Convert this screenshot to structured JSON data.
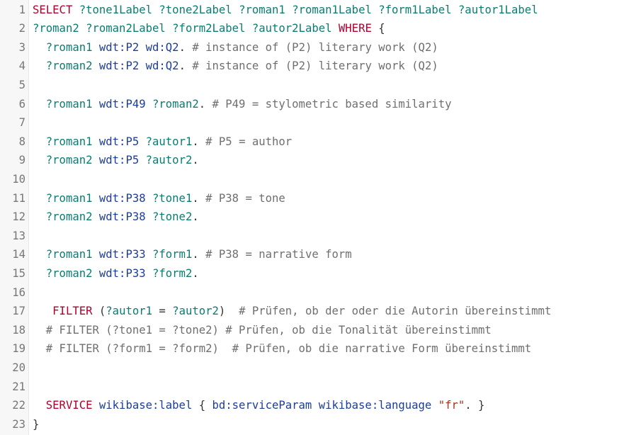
{
  "editor": {
    "lines": [
      {
        "number": "1",
        "tokens": [
          {
            "t": "kw",
            "v": "SELECT"
          },
          {
            "t": "pl",
            "v": " "
          },
          {
            "t": "var",
            "v": "?tone1Label"
          },
          {
            "t": "pl",
            "v": " "
          },
          {
            "t": "var",
            "v": "?tone2Label"
          },
          {
            "t": "pl",
            "v": " "
          },
          {
            "t": "var",
            "v": "?roman1"
          },
          {
            "t": "pl",
            "v": " "
          },
          {
            "t": "var",
            "v": "?roman1Label"
          },
          {
            "t": "pl",
            "v": " "
          },
          {
            "t": "var",
            "v": "?form1Label"
          },
          {
            "t": "pl",
            "v": " "
          },
          {
            "t": "var",
            "v": "?autor1Label"
          }
        ]
      },
      {
        "number": "2",
        "tokens": [
          {
            "t": "var",
            "v": "?roman2"
          },
          {
            "t": "pl",
            "v": " "
          },
          {
            "t": "var",
            "v": "?roman2Label"
          },
          {
            "t": "pl",
            "v": " "
          },
          {
            "t": "var",
            "v": "?form2Label"
          },
          {
            "t": "pl",
            "v": " "
          },
          {
            "t": "var",
            "v": "?autor2Label"
          },
          {
            "t": "pl",
            "v": " "
          },
          {
            "t": "kw",
            "v": "WHERE"
          },
          {
            "t": "pl",
            "v": " {"
          }
        ]
      },
      {
        "number": "3",
        "tokens": [
          {
            "t": "pl",
            "v": "  "
          },
          {
            "t": "var",
            "v": "?roman1"
          },
          {
            "t": "pl",
            "v": " "
          },
          {
            "t": "pfx",
            "v": "wdt:P2"
          },
          {
            "t": "pl",
            "v": " "
          },
          {
            "t": "pfx",
            "v": "wd:Q2"
          },
          {
            "t": "pl",
            "v": ". "
          },
          {
            "t": "cmt",
            "v": "# instance of (P2) literary work (Q2)"
          }
        ]
      },
      {
        "number": "4",
        "tokens": [
          {
            "t": "pl",
            "v": "  "
          },
          {
            "t": "var",
            "v": "?roman2"
          },
          {
            "t": "pl",
            "v": " "
          },
          {
            "t": "pfx",
            "v": "wdt:P2"
          },
          {
            "t": "pl",
            "v": " "
          },
          {
            "t": "pfx",
            "v": "wd:Q2"
          },
          {
            "t": "pl",
            "v": ". "
          },
          {
            "t": "cmt",
            "v": "# instance of (P2) literary work (Q2)"
          }
        ]
      },
      {
        "number": "5",
        "tokens": []
      },
      {
        "number": "6",
        "tokens": [
          {
            "t": "pl",
            "v": "  "
          },
          {
            "t": "var",
            "v": "?roman1"
          },
          {
            "t": "pl",
            "v": " "
          },
          {
            "t": "pfx",
            "v": "wdt:P49"
          },
          {
            "t": "pl",
            "v": " "
          },
          {
            "t": "var",
            "v": "?roman2"
          },
          {
            "t": "pl",
            "v": ". "
          },
          {
            "t": "cmt",
            "v": "# P49 = stylometric based similarity"
          }
        ]
      },
      {
        "number": "7",
        "tokens": []
      },
      {
        "number": "8",
        "tokens": [
          {
            "t": "pl",
            "v": "  "
          },
          {
            "t": "var",
            "v": "?roman1"
          },
          {
            "t": "pl",
            "v": " "
          },
          {
            "t": "pfx",
            "v": "wdt:P5"
          },
          {
            "t": "pl",
            "v": " "
          },
          {
            "t": "var",
            "v": "?autor1"
          },
          {
            "t": "pl",
            "v": ". "
          },
          {
            "t": "cmt",
            "v": "# P5 = author"
          }
        ]
      },
      {
        "number": "9",
        "tokens": [
          {
            "t": "pl",
            "v": "  "
          },
          {
            "t": "var",
            "v": "?roman2"
          },
          {
            "t": "pl",
            "v": " "
          },
          {
            "t": "pfx",
            "v": "wdt:P5"
          },
          {
            "t": "pl",
            "v": " "
          },
          {
            "t": "var",
            "v": "?autor2"
          },
          {
            "t": "pl",
            "v": "."
          }
        ]
      },
      {
        "number": "10",
        "tokens": []
      },
      {
        "number": "11",
        "tokens": [
          {
            "t": "pl",
            "v": "  "
          },
          {
            "t": "var",
            "v": "?roman1"
          },
          {
            "t": "pl",
            "v": " "
          },
          {
            "t": "pfx",
            "v": "wdt:P38"
          },
          {
            "t": "pl",
            "v": " "
          },
          {
            "t": "var",
            "v": "?tone1"
          },
          {
            "t": "pl",
            "v": ". "
          },
          {
            "t": "cmt",
            "v": "# P38 = tone"
          }
        ]
      },
      {
        "number": "12",
        "tokens": [
          {
            "t": "pl",
            "v": "  "
          },
          {
            "t": "var",
            "v": "?roman2"
          },
          {
            "t": "pl",
            "v": " "
          },
          {
            "t": "pfx",
            "v": "wdt:P38"
          },
          {
            "t": "pl",
            "v": " "
          },
          {
            "t": "var",
            "v": "?tone2"
          },
          {
            "t": "pl",
            "v": "."
          }
        ]
      },
      {
        "number": "13",
        "tokens": []
      },
      {
        "number": "14",
        "tokens": [
          {
            "t": "pl",
            "v": "  "
          },
          {
            "t": "var",
            "v": "?roman1"
          },
          {
            "t": "pl",
            "v": " "
          },
          {
            "t": "pfx",
            "v": "wdt:P33"
          },
          {
            "t": "pl",
            "v": " "
          },
          {
            "t": "var",
            "v": "?form1"
          },
          {
            "t": "pl",
            "v": ". "
          },
          {
            "t": "cmt",
            "v": "# P38 = narrative form"
          }
        ]
      },
      {
        "number": "15",
        "tokens": [
          {
            "t": "pl",
            "v": "  "
          },
          {
            "t": "var",
            "v": "?roman2"
          },
          {
            "t": "pl",
            "v": " "
          },
          {
            "t": "pfx",
            "v": "wdt:P33"
          },
          {
            "t": "pl",
            "v": " "
          },
          {
            "t": "var",
            "v": "?form2"
          },
          {
            "t": "pl",
            "v": "."
          }
        ]
      },
      {
        "number": "16",
        "tokens": []
      },
      {
        "number": "17",
        "tokens": [
          {
            "t": "pl",
            "v": "   "
          },
          {
            "t": "kw",
            "v": "FILTER"
          },
          {
            "t": "pl",
            "v": " ("
          },
          {
            "t": "var",
            "v": "?autor1"
          },
          {
            "t": "pl",
            "v": " = "
          },
          {
            "t": "var",
            "v": "?autor2"
          },
          {
            "t": "pl",
            "v": ")  "
          },
          {
            "t": "cmt",
            "v": "# Prüfen, ob der oder die Autorin übereinstimmt"
          }
        ]
      },
      {
        "number": "18",
        "tokens": [
          {
            "t": "pl",
            "v": "  "
          },
          {
            "t": "cmt",
            "v": "# FILTER (?tone1 = ?tone2) # Prüfen, ob die Tonalität übereinstimmt"
          }
        ]
      },
      {
        "number": "19",
        "tokens": [
          {
            "t": "pl",
            "v": "  "
          },
          {
            "t": "cmt",
            "v": "# FILTER (?form1 = ?form2)  # Prüfen, ob die narrative Form übereinstimmt"
          }
        ]
      },
      {
        "number": "20",
        "tokens": []
      },
      {
        "number": "21",
        "tokens": []
      },
      {
        "number": "22",
        "tokens": [
          {
            "t": "pl",
            "v": "  "
          },
          {
            "t": "kw",
            "v": "SERVICE"
          },
          {
            "t": "pl",
            "v": " "
          },
          {
            "t": "pfx",
            "v": "wikibase:label"
          },
          {
            "t": "pl",
            "v": " { "
          },
          {
            "t": "pfx",
            "v": "bd:serviceParam"
          },
          {
            "t": "pl",
            "v": " "
          },
          {
            "t": "pfx",
            "v": "wikibase:language"
          },
          {
            "t": "pl",
            "v": " "
          },
          {
            "t": "str",
            "v": "\"fr\""
          },
          {
            "t": "pl",
            "v": ". }"
          }
        ]
      },
      {
        "number": "23",
        "tokens": [
          {
            "t": "pl",
            "v": "}"
          }
        ]
      }
    ]
  },
  "colors": {
    "keyword": "#b0002b",
    "variable": "#0a7d72",
    "prefixed_name": "#1c3d9c",
    "string": "#a3361b",
    "comment": "#6f6f6f",
    "gutter_background": "#f7f7f7"
  }
}
